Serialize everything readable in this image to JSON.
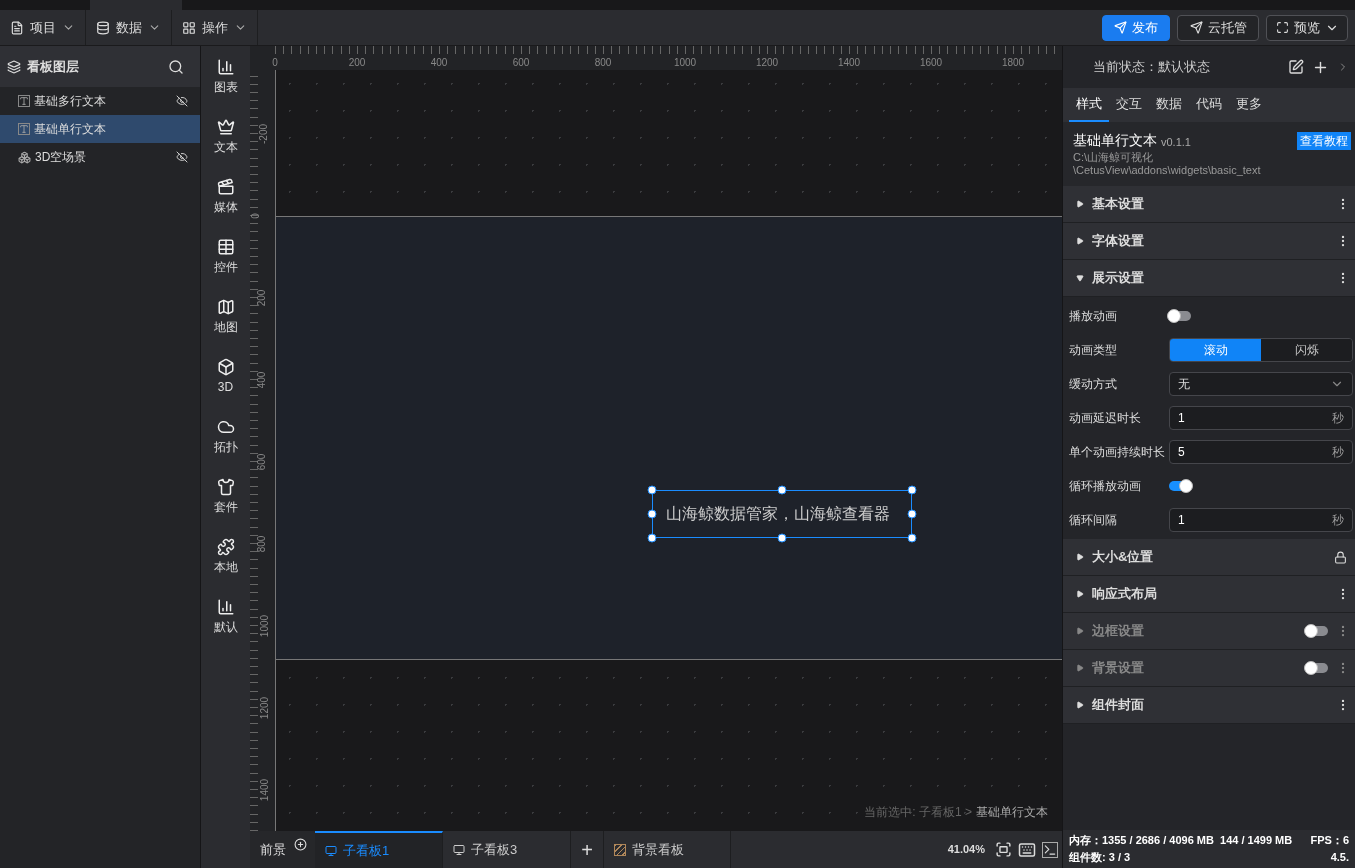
{
  "menus": [
    {
      "label": "项目",
      "kind": "file"
    },
    {
      "label": "数据",
      "kind": "database"
    },
    {
      "label": "操作",
      "kind": "grid"
    }
  ],
  "actions": [
    {
      "label": "发布",
      "kind": "primary"
    },
    {
      "label": "云托管",
      "kind": "secondary"
    },
    {
      "label": "预览",
      "kind": "dropdown"
    }
  ],
  "layers": {
    "title": "看板图层",
    "items": [
      {
        "label": "基础多行文本",
        "kind": "text",
        "hidden": true,
        "selected": false
      },
      {
        "label": "基础单行文本",
        "kind": "text",
        "hidden": false,
        "selected": true
      },
      {
        "label": "3D空场景",
        "kind": "scene",
        "hidden": true,
        "selected": false
      }
    ]
  },
  "widget_categories": [
    {
      "label": "图表",
      "kind": "chart"
    },
    {
      "label": "文本",
      "kind": "crown"
    },
    {
      "label": "媒体",
      "kind": "media"
    },
    {
      "label": "控件",
      "kind": "table"
    },
    {
      "label": "地图",
      "kind": "map"
    },
    {
      "label": "3D",
      "kind": "cube"
    },
    {
      "label": "拓扑",
      "kind": "cloud"
    },
    {
      "label": "套件",
      "kind": "shirt"
    },
    {
      "label": "本地",
      "kind": "puzzle"
    },
    {
      "label": "默认",
      "kind": "chart"
    }
  ],
  "ruler": {
    "x_labels": [
      "0",
      "200",
      "400",
      "600",
      "800",
      "1000",
      "1200",
      "1400",
      "1600",
      "1800"
    ],
    "y_labels": [
      "-200",
      "0",
      "200",
      "400",
      "600",
      "800",
      "1000",
      "1200",
      "1400"
    ]
  },
  "canvas": {
    "text_widget": "山海鲸数据管家，山海鲸查看器",
    "breadcrumb": {
      "prefix": "当前选中: 子看板1 >",
      "current": "基础单行文本"
    }
  },
  "bottom_bar": {
    "foreground": "前景",
    "tabs": [
      {
        "label": "子看板1",
        "selected": true
      },
      {
        "label": "子看板3",
        "selected": false
      }
    ],
    "add": "+",
    "background": "背景看板",
    "zoom": "41.04%"
  },
  "right_panel": {
    "state": "当前状态：默认状态",
    "tabs": [
      {
        "label": "样式",
        "selected": true
      },
      {
        "label": "交互",
        "selected": false
      },
      {
        "label": "数据",
        "selected": false
      },
      {
        "label": "代码",
        "selected": false
      },
      {
        "label": "更多",
        "selected": false
      }
    ],
    "widget": {
      "name": "基础单行文本",
      "version": "v0.1.1",
      "path": [
        "C:\\山海鲸可视化",
        "\\CetusView\\addons\\widgets\\basic_text"
      ],
      "tutorial": "查看教程"
    },
    "sections": [
      {
        "label": "基本设置",
        "expanded": false,
        "disabled": false,
        "kind": "menu"
      },
      {
        "label": "字体设置",
        "expanded": false,
        "disabled": false,
        "kind": "menu"
      },
      {
        "label": "展示设置",
        "expanded": true,
        "disabled": false,
        "kind": "menu",
        "fields": [
          {
            "label": "播放动画",
            "kind": "toggle",
            "on": false
          },
          {
            "label": "动画类型",
            "kind": "segmented",
            "options": [
              {
                "label": "滚动",
                "selected": true
              },
              {
                "label": "闪烁",
                "selected": false
              }
            ]
          },
          {
            "label": "缓动方式",
            "kind": "select",
            "value": "无"
          },
          {
            "label": "动画延迟时长",
            "kind": "number",
            "value": "1",
            "unit": "秒"
          },
          {
            "label": "单个动画持续时长",
            "kind": "number",
            "value": "5",
            "unit": "秒"
          },
          {
            "label": "循环播放动画",
            "kind": "toggle",
            "on": true
          },
          {
            "label": "循环间隔",
            "kind": "number",
            "value": "1",
            "unit": "秒"
          }
        ]
      },
      {
        "label": "大小&位置",
        "expanded": false,
        "disabled": false,
        "kind": "lock"
      },
      {
        "label": "响应式布局",
        "expanded": false,
        "disabled": false,
        "kind": "menu"
      },
      {
        "label": "边框设置",
        "expanded": false,
        "disabled": true,
        "kind": "toggle",
        "on": false
      },
      {
        "label": "背景设置",
        "expanded": false,
        "disabled": true,
        "kind": "toggle",
        "on": false
      },
      {
        "label": "组件封面",
        "expanded": false,
        "disabled": false,
        "kind": "menu"
      }
    ]
  },
  "status": {
    "memory": "内存：1355 / 2686 / 4096 MB  144 / 1499 MB",
    "fps": "FPS：6",
    "count": "组件数: 3 / 3",
    "version": "4.5."
  }
}
